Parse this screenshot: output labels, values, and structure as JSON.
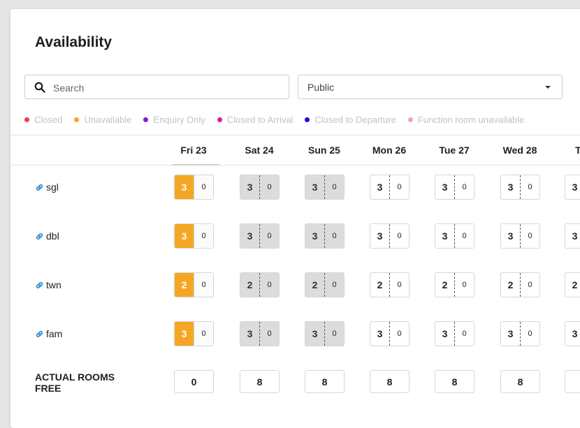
{
  "page": {
    "title": "Availability"
  },
  "search": {
    "placeholder": "Search"
  },
  "rate_select": {
    "value": "Public"
  },
  "legend": [
    {
      "label": "Closed",
      "color": "#e8415a"
    },
    {
      "label": "Unavailable",
      "color": "#f5a623"
    },
    {
      "label": "Enquiry Only",
      "color": "#8a16d8"
    },
    {
      "label": "Closed to Arrival",
      "color": "#e0189c"
    },
    {
      "label": "Closed to Departure",
      "color": "#1a12d6"
    },
    {
      "label": "Function room unavailable",
      "color": "#f4a3ad"
    }
  ],
  "days": [
    "Fri 23",
    "Sat 24",
    "Sun 25",
    "Mon 26",
    "Tue 27",
    "Wed 28",
    "Thu"
  ],
  "rooms": [
    {
      "name": "sgl",
      "available": [
        "3",
        "3",
        "3",
        "3",
        "3",
        "3",
        "3"
      ],
      "booked": [
        "0",
        "0",
        "0",
        "0",
        "0",
        "0",
        ""
      ]
    },
    {
      "name": "dbl",
      "available": [
        "3",
        "3",
        "3",
        "3",
        "3",
        "3",
        "3"
      ],
      "booked": [
        "0",
        "0",
        "0",
        "0",
        "0",
        "0",
        ""
      ]
    },
    {
      "name": "twn",
      "available": [
        "2",
        "2",
        "2",
        "2",
        "2",
        "2",
        "2"
      ],
      "booked": [
        "0",
        "0",
        "0",
        "0",
        "0",
        "0",
        ""
      ]
    },
    {
      "name": "fam",
      "available": [
        "3",
        "3",
        "3",
        "3",
        "3",
        "3",
        "3"
      ],
      "booked": [
        "0",
        "0",
        "0",
        "0",
        "0",
        "0",
        ""
      ]
    }
  ],
  "actual_rooms_free": {
    "label": "ACTUAL ROOMS FREE",
    "values": [
      "0",
      "8",
      "8",
      "8",
      "8",
      "8",
      ""
    ]
  },
  "colors": {
    "unavailable": "#f5a623",
    "weekend": "#dcdcdc",
    "link_icon": "#2a8fd8"
  }
}
